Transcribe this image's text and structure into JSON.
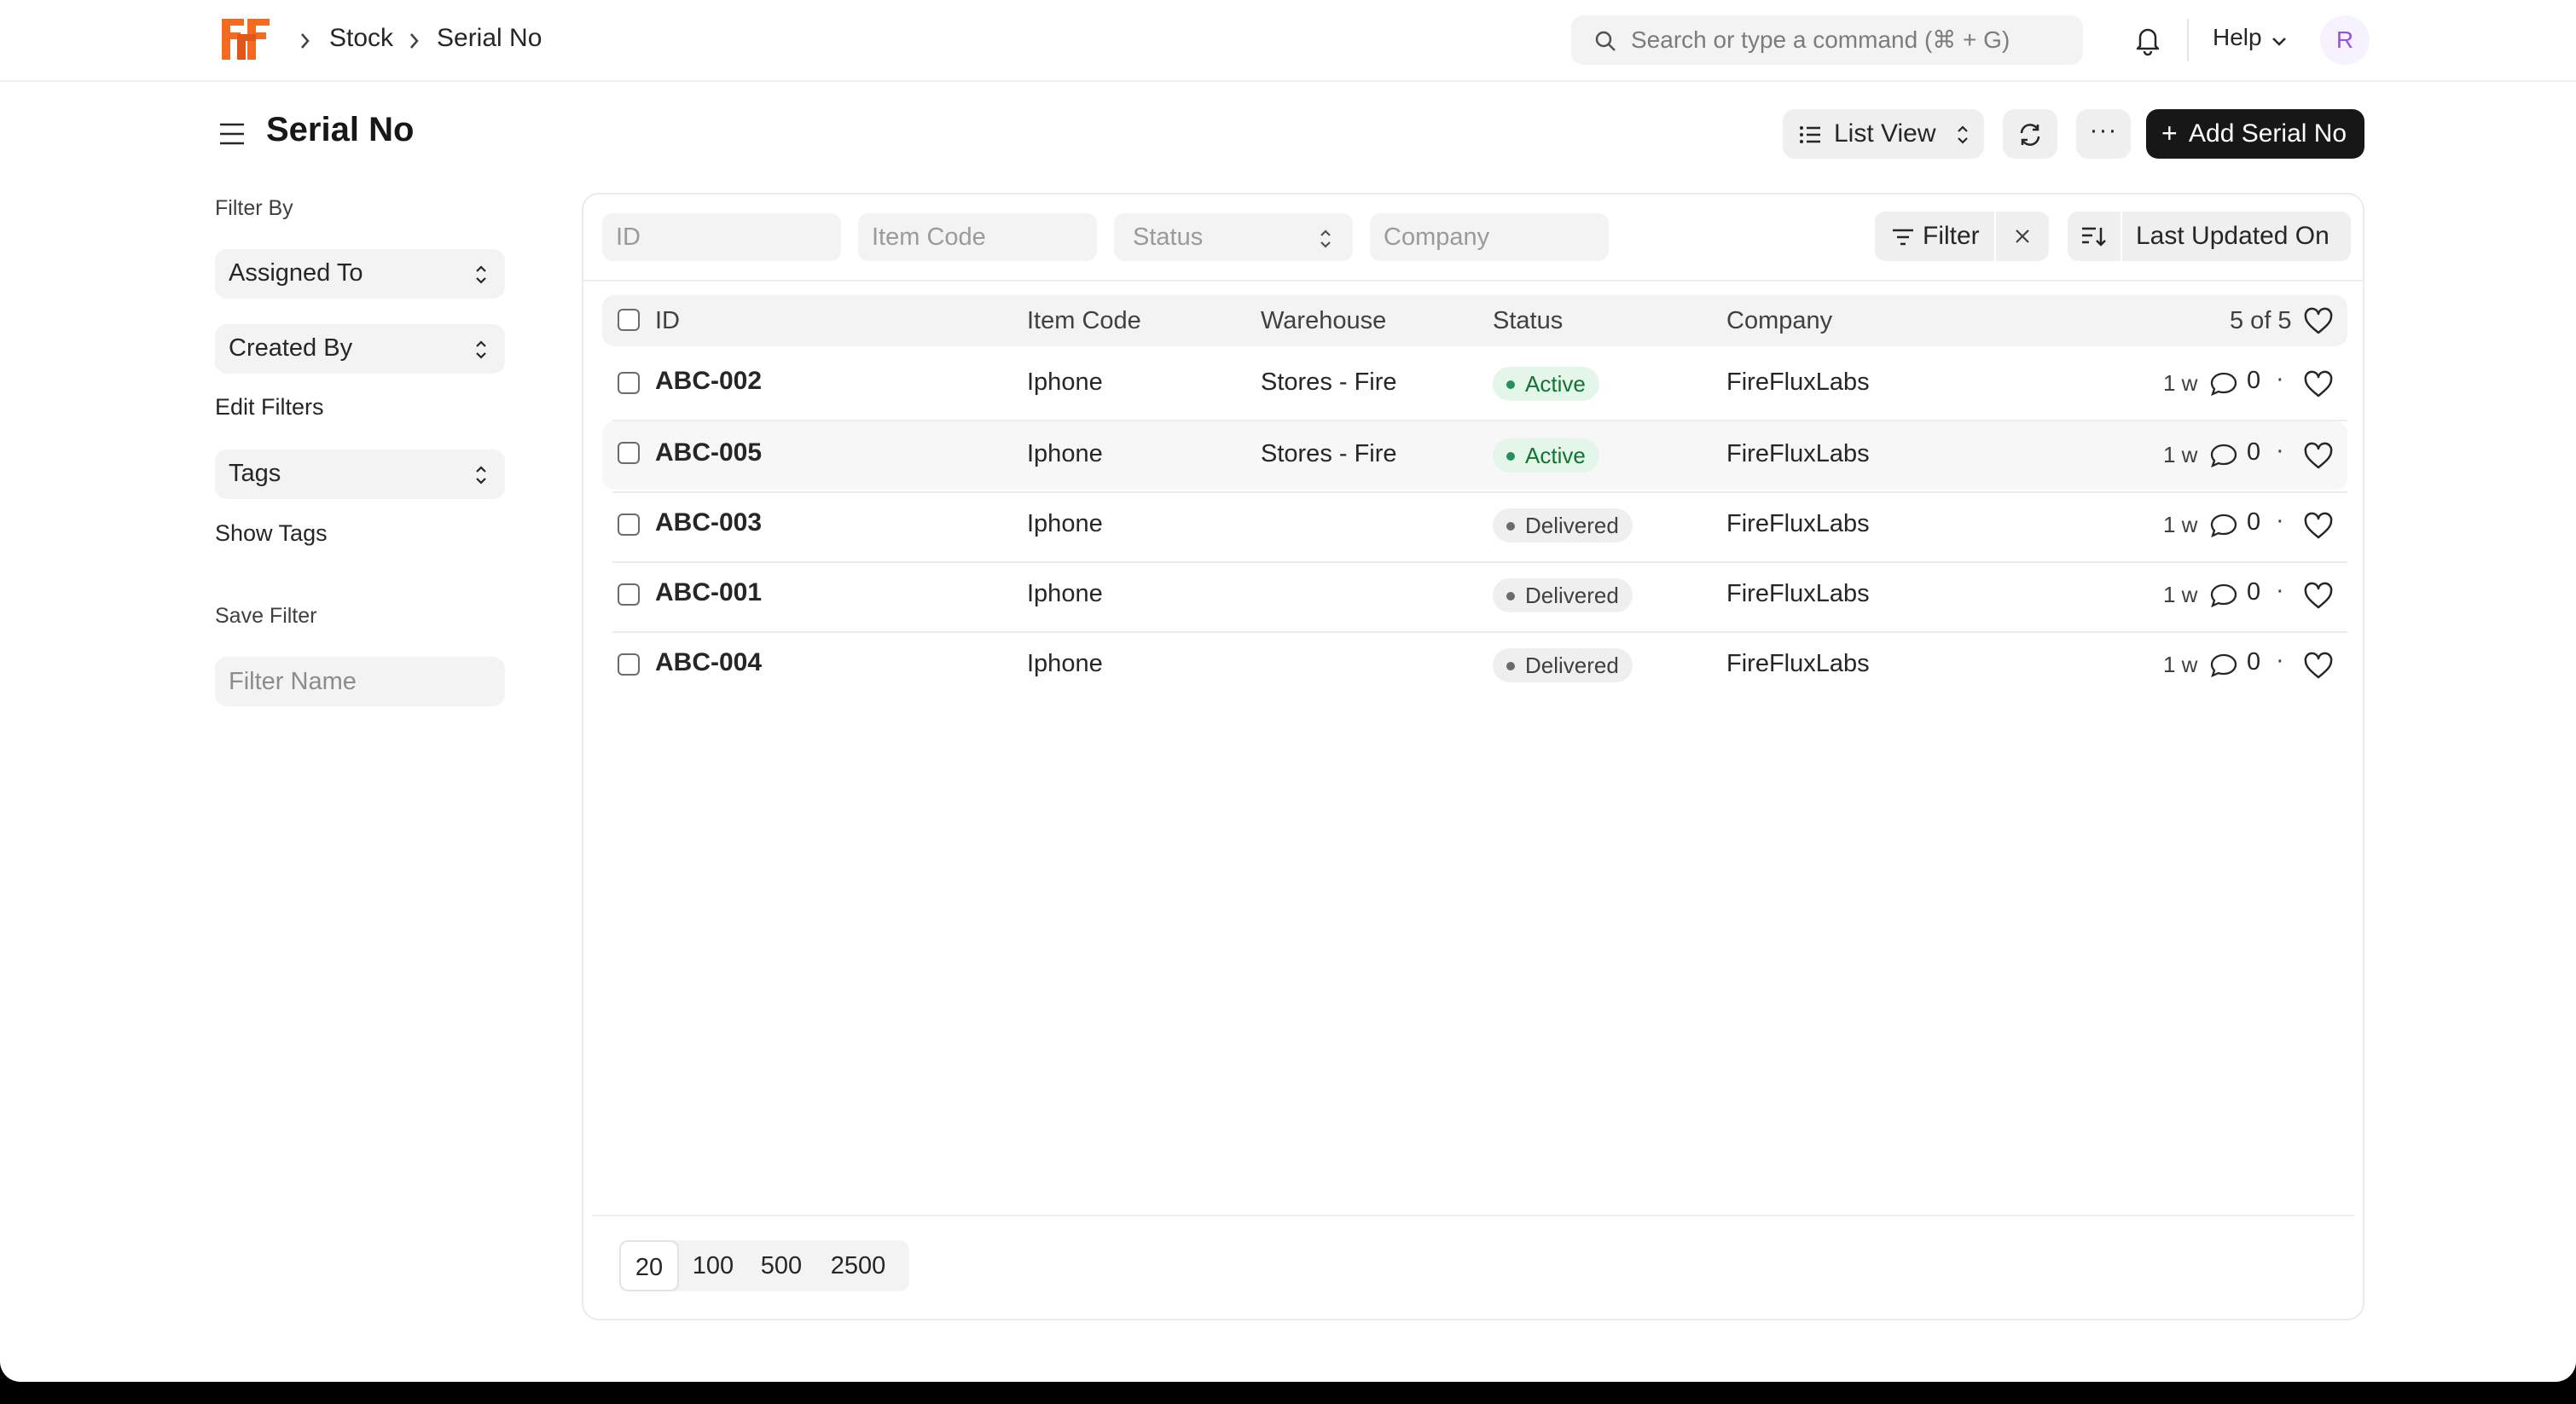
{
  "navbar": {
    "breadcrumbs": [
      "Stock",
      "Serial No"
    ],
    "search_placeholder": "Search or type a command (⌘ + G)",
    "help_label": "Help",
    "avatar_initial": "R",
    "logo_color": "#f26b21"
  },
  "page": {
    "title": "Serial No",
    "list_view_label": "List View",
    "more_label": "···",
    "add_button_label": "Add Serial No"
  },
  "sidebar": {
    "filter_by_label": "Filter By",
    "assigned_to": "Assigned To",
    "created_by": "Created By",
    "edit_filters": "Edit Filters",
    "tags": "Tags",
    "show_tags": "Show Tags",
    "save_filter_label": "Save Filter",
    "filter_name_placeholder": "Filter Name"
  },
  "filters": {
    "id_placeholder": "ID",
    "item_code_placeholder": "Item Code",
    "status_placeholder": "Status",
    "company_placeholder": "Company",
    "filter_label": "Filter",
    "sort_label": "Last Updated On"
  },
  "table": {
    "columns": [
      "ID",
      "Item Code",
      "Warehouse",
      "Status",
      "Company"
    ],
    "count": "5 of 5",
    "rows": [
      {
        "id": "ABC-002",
        "item_code": "Iphone",
        "warehouse": "Stores - Fire",
        "status": "Active",
        "company": "FireFluxLabs",
        "modified": "1 w",
        "comments": "0"
      },
      {
        "id": "ABC-005",
        "item_code": "Iphone",
        "warehouse": "Stores - Fire",
        "status": "Active",
        "company": "FireFluxLabs",
        "modified": "1 w",
        "comments": "0"
      },
      {
        "id": "ABC-003",
        "item_code": "Iphone",
        "warehouse": "",
        "status": "Delivered",
        "company": "FireFluxLabs",
        "modified": "1 w",
        "comments": "0"
      },
      {
        "id": "ABC-001",
        "item_code": "Iphone",
        "warehouse": "",
        "status": "Delivered",
        "company": "FireFluxLabs",
        "modified": "1 w",
        "comments": "0"
      },
      {
        "id": "ABC-004",
        "item_code": "Iphone",
        "warehouse": "",
        "status": "Delivered",
        "company": "FireFluxLabs",
        "modified": "1 w",
        "comments": "0"
      }
    ]
  },
  "pagination": {
    "page_sizes": [
      "20",
      "100",
      "500",
      "2500"
    ],
    "selected": "20"
  },
  "status_colors": {
    "active_bg": "#e4f5e9",
    "active_text": "#137333",
    "delivered_bg": "#efefef",
    "delivered_text": "#404040"
  }
}
